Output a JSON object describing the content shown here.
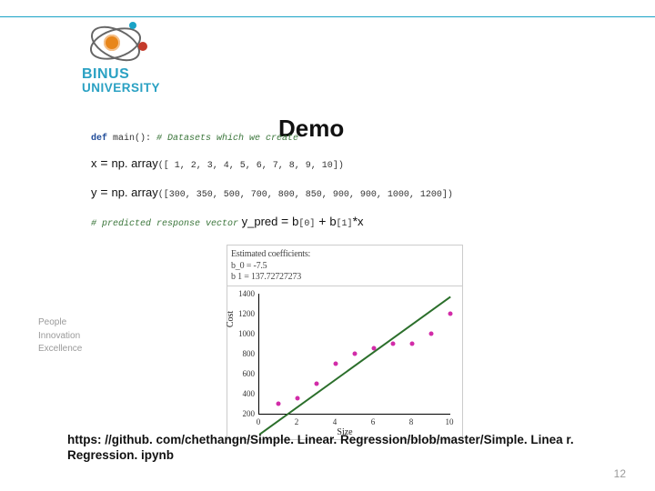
{
  "logo": {
    "line1": "BINUS",
    "line2": "UNIVERSITY"
  },
  "title": "Demo",
  "tagline": {
    "l1": "People",
    "l2": "Innovation",
    "l3": "Excellence"
  },
  "code": {
    "defkw": "def",
    "main": " main():",
    "comment1": " # Datasets which we create",
    "xvar": "x",
    "eq": " = ",
    "nparr": "np. array",
    "xvals": "([ 1, 2, 3, 4, 5, 6, 7, 8, 9, 10])",
    "yvar": "y",
    "yvals": "([300, 350, 500, 700, 800, 850, 900, 900, 1000, 1200])",
    "comment2": "# predicted response vector",
    "ypred": " y_pred ",
    "eq2": "= ",
    "term1": "b",
    "sub0": "[0]",
    "plus": " + ",
    "term2": "b",
    "sub1": "[1]",
    "star": "*",
    "xend": "x"
  },
  "link": "https: //github. com/chethangn/Simple. Linear. Regression/blob/master/Simple. Linea r. Regression. ipynb",
  "page": "12",
  "chart_data": {
    "type": "scatter",
    "title": "Estimated coefficients:",
    "sub1": "b_0 = -7.5",
    "sub2": "b 1 = 137.72727273",
    "xlabel": "Size",
    "ylabel": "Cost",
    "x": [
      1,
      2,
      3,
      4,
      5,
      6,
      7,
      8,
      9,
      10
    ],
    "y": [
      300,
      350,
      500,
      700,
      800,
      850,
      900,
      900,
      1000,
      1200
    ],
    "xlim": [
      0,
      10
    ],
    "ylim": [
      200,
      1400
    ],
    "xticks": [
      0,
      2,
      4,
      6,
      8,
      10
    ],
    "yticks": [
      200,
      400,
      600,
      800,
      1000,
      1200,
      1400
    ],
    "regression": {
      "b0": -7.5,
      "b1": 137.7273
    }
  }
}
